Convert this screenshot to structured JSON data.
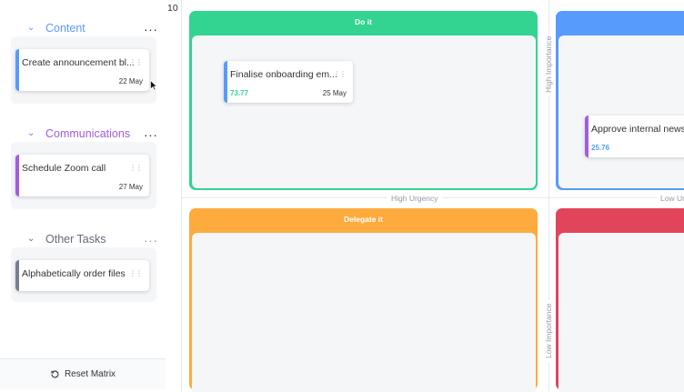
{
  "sidebar": {
    "groups": [
      {
        "name": "Content",
        "color": "#579bfc",
        "cards": [
          {
            "title": "Create announcement bl...",
            "date": "22 May",
            "color": "#579bfc"
          }
        ]
      },
      {
        "name": "Communications",
        "color": "#a25ddc",
        "cards": [
          {
            "title": "Schedule Zoom call",
            "date": "27 May",
            "color": "#a25ddc"
          }
        ]
      },
      {
        "name": "Other Tasks",
        "color": "#676879",
        "cards": [
          {
            "title": "Alphabetically order files",
            "color": "#797e93"
          }
        ]
      }
    ],
    "reset_label": "Reset Matrix"
  },
  "matrix": {
    "count": "10",
    "quadrants": {
      "do_it": {
        "title": "Do it",
        "color": "#33d391"
      },
      "schedule": {
        "title": "",
        "color": "#579bfc"
      },
      "delegate": {
        "title": "Delegate it",
        "color": "#fdab3d"
      },
      "eliminate": {
        "title": "",
        "color": "#e2445c"
      }
    },
    "cards": {
      "onboarding": {
        "title": "Finalise onboarding em...",
        "date": "25 May",
        "score": "73.77",
        "color": "#579bfc",
        "score_color": "#33d391"
      },
      "newsletter": {
        "title": "Approve internal newsl",
        "score": "25.76",
        "color": "#a25ddc",
        "score_color": "#579bfc"
      }
    },
    "axes": {
      "high_urgency": "High Urgency",
      "low_urgency": "Low Ur",
      "high_importance": "High Importance",
      "low_importance": "Low Importance"
    }
  }
}
